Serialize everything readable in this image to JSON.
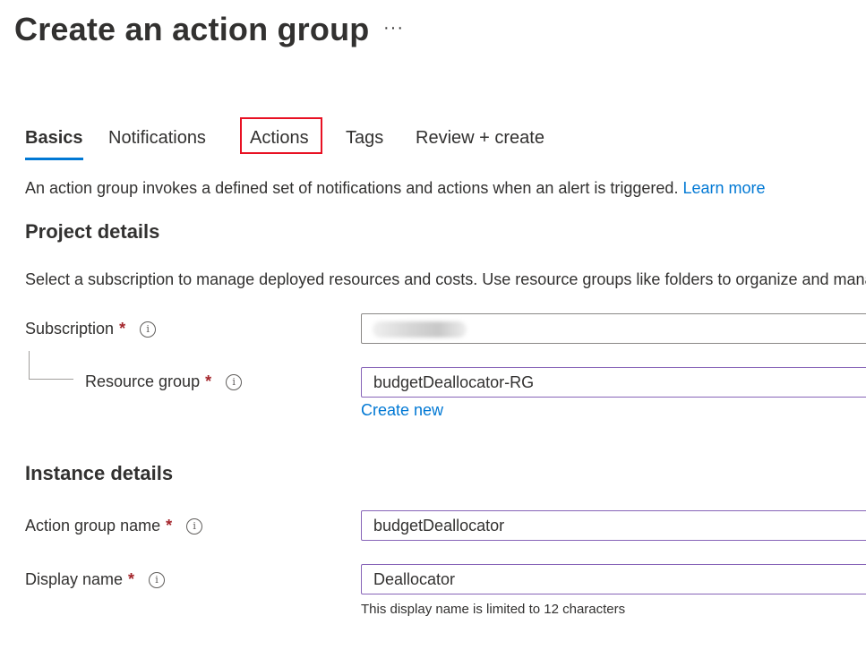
{
  "page": {
    "title": "Create an action group",
    "more_label": "···"
  },
  "tabs": [
    {
      "label": "Basics"
    },
    {
      "label": "Notifications"
    },
    {
      "label": "Actions"
    },
    {
      "label": "Tags"
    },
    {
      "label": "Review + create"
    }
  ],
  "intro": {
    "text": "An action group invokes a defined set of notifications and actions when an alert is triggered. ",
    "link": "Learn more"
  },
  "project_details": {
    "heading": "Project details",
    "description": "Select a subscription to manage deployed resources and costs. Use resource groups like folders to organize and manage all your resources.",
    "subscription": {
      "label": "Subscription",
      "required_mark": "*",
      "value": ""
    },
    "resource_group": {
      "label": "Resource group",
      "required_mark": "*",
      "value": "budgetDeallocator-RG",
      "create_new": "Create new"
    }
  },
  "instance_details": {
    "heading": "Instance details",
    "action_group_name": {
      "label": "Action group name",
      "required_mark": "*",
      "value": "budgetDeallocator"
    },
    "display_name": {
      "label": "Display name",
      "required_mark": "*",
      "value": "Deallocator",
      "hint": "This display name is limited to 12 characters"
    }
  },
  "info_icon_glyph": "i",
  "colors": {
    "accent": "#0078d4",
    "highlight_box": "#e81123",
    "required": "#a4262c",
    "focused_border": "#8764b8"
  }
}
